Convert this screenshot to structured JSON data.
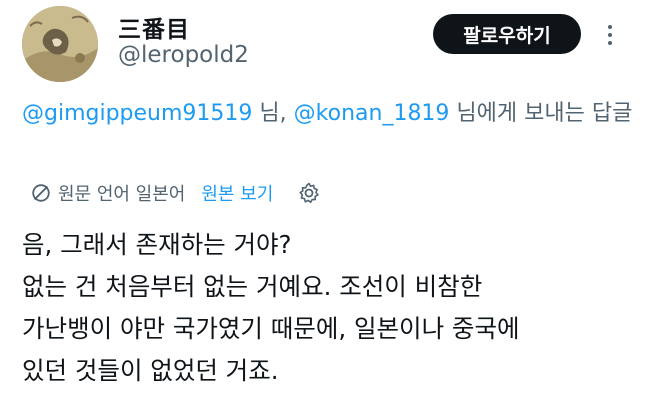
{
  "user": {
    "display_name": "三番目",
    "handle": "@leropold2",
    "avatar_icon": "avatar-painting"
  },
  "follow_button": {
    "label": "팔로우하기"
  },
  "reply_context": {
    "mention1": "@gimgippeum91519",
    "sep1": " 님, ",
    "mention2": "@konan_1819",
    "suffix": " 님에게 보내는 답글"
  },
  "translation": {
    "label": "원문 언어 일본어",
    "show_original": "원본 보기",
    "globe_icon": "translate-globe-icon",
    "settings_icon": "gear-icon"
  },
  "tweet": {
    "lines": [
      "음, 그래서 존재하는 거야?",
      "없는 건 처음부터 없는 거예요. 조선이 비참한",
      "가난뱅이 야만 국가였기 때문에, 일본이나 중국에",
      "있던 것들이 없었던 거죠."
    ]
  },
  "colors": {
    "text": "#0f1419",
    "secondary": "#536471",
    "link": "#1d9bf0",
    "button_bg": "#0f1419"
  }
}
